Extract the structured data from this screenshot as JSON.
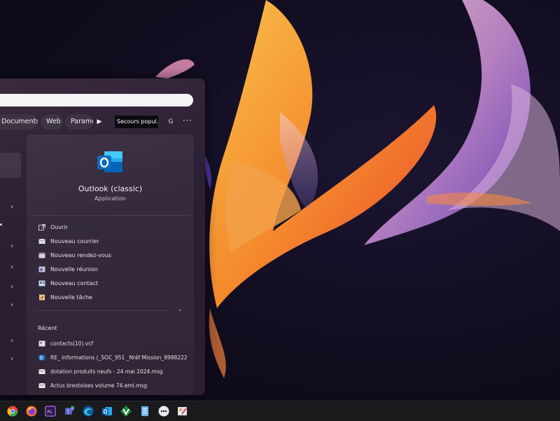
{
  "search": {
    "placeholder": ""
  },
  "filters": {
    "documents": "Documents",
    "web": "Web",
    "parametres": "Paramè",
    "secours": "Secours popul...",
    "g": "G",
    "more": "···"
  },
  "app": {
    "name": "Outlook (classic)",
    "type": "Application",
    "icon": "outlook-icon",
    "brand_color": "#0f6cbd"
  },
  "actions": [
    {
      "label": "Ouvrir",
      "icon": "open-icon"
    },
    {
      "label": "Nouveau courrier",
      "icon": "mail-icon"
    },
    {
      "label": "Nouveau rendez-vous",
      "icon": "calendar-icon"
    },
    {
      "label": "Nouvelle réunion",
      "icon": "meeting-icon"
    },
    {
      "label": "Nouveau contact",
      "icon": "contact-icon"
    },
    {
      "label": "Nouvelle tâche",
      "icon": "task-icon"
    }
  ],
  "recent": {
    "title": "Récent",
    "items": [
      {
        "label": "contacts(10).vcf",
        "icon": "vcard-icon"
      },
      {
        "label": "RE_ informations (_SOC_951 _Nréf Mission_9988222...",
        "icon": "outlook-file-icon"
      },
      {
        "label": "dotation produits neufs - 24 mai 2024.msg",
        "icon": "mail-file-icon"
      },
      {
        "label": "Actus brestoises volume 74.eml.msg",
        "icon": "mail-file-icon"
      }
    ]
  },
  "taskbar": {
    "apps": [
      "chrome-icon",
      "firefox-icon",
      "photoshop-icon",
      "teams-icon",
      "edge-icon",
      "outlook-icon",
      "vim-icon",
      "notepad-icon",
      "chat-icon",
      "paint-icon"
    ]
  }
}
